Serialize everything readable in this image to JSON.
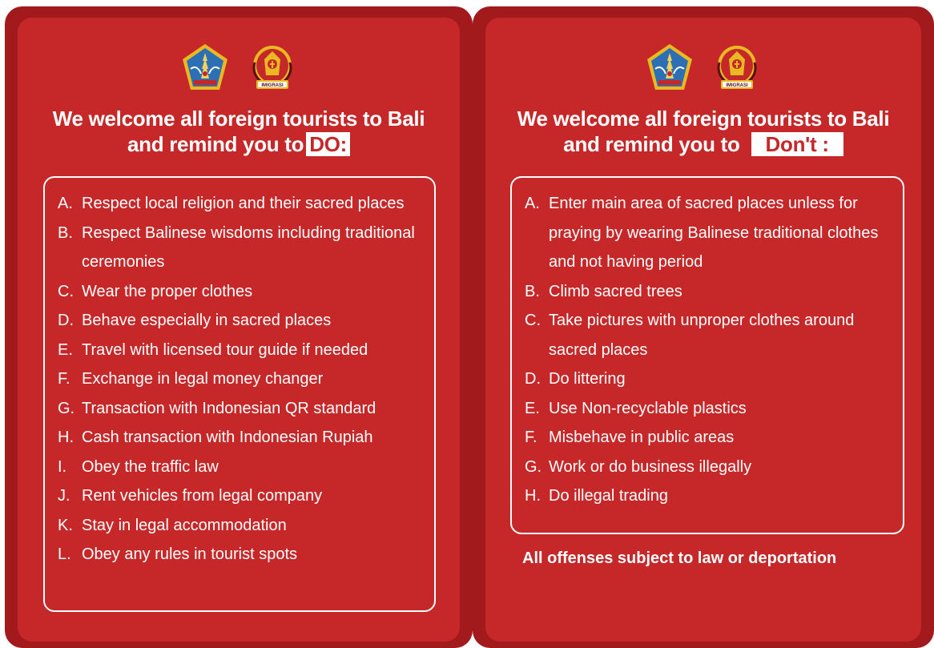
{
  "panels": [
    {
      "title_line1": "We welcome all foreign tourists to Bali",
      "title_line2": "and remind you to",
      "highlight": "DO:",
      "items": [
        {
          "letter": "A.",
          "text": "Respect local religion and their sacred places"
        },
        {
          "letter": "B.",
          "text": "Respect Balinese wisdoms including traditional ceremonies"
        },
        {
          "letter": "C.",
          "text": "Wear the proper clothes"
        },
        {
          "letter": "D.",
          "text": "Behave especially in sacred places"
        },
        {
          "letter": "E.",
          "text": "Travel with licensed tour guide if needed"
        },
        {
          "letter": "F.",
          "text": "Exchange in legal money changer"
        },
        {
          "letter": "G.",
          "text": "Transaction with Indonesian QR standard"
        },
        {
          "letter": "H.",
          "text": "Cash transaction with Indonesian Rupiah"
        },
        {
          "letter": "I.",
          "text": "Obey the traffic law"
        },
        {
          "letter": "J.",
          "text": "Rent vehicles from legal company"
        },
        {
          "letter": "K.",
          "text": "Stay in legal accommodation"
        },
        {
          "letter": "L.",
          "text": "Obey any rules in tourist spots"
        }
      ]
    },
    {
      "title_line1": "We welcome all foreign tourists to Bali",
      "title_line2": "and remind you to",
      "highlight": "Don't :",
      "items": [
        {
          "letter": "A.",
          "text": "Enter main area of sacred places unless for praying by wearing Balinese traditional clothes and not having period"
        },
        {
          "letter": "B.",
          "text": "Climb sacred trees"
        },
        {
          "letter": "C.",
          "text": "Take pictures with unproper clothes around sacred places"
        },
        {
          "letter": "D.",
          "text": "Do littering"
        },
        {
          "letter": "E.",
          "text": "Use Non-recyclable plastics"
        },
        {
          "letter": "F.",
          "text": "Misbehave in public areas"
        },
        {
          "letter": "G.",
          "text": "Work or do business illegally"
        },
        {
          "letter": "H.",
          "text": "Do illegal trading"
        }
      ],
      "footer": "All offenses subject to law or deportation"
    }
  ],
  "logos": {
    "left": "bali-province-emblem-icon",
    "right": "imigrasi-emblem-icon",
    "seal_text": "IMIGRASI"
  },
  "colors": {
    "panel_outer": "#a31a1d",
    "panel_inner": "#c62829",
    "text": "#ffffff",
    "emblem_blue": "#2d6fb5",
    "emblem_gold": "#e8b923"
  }
}
